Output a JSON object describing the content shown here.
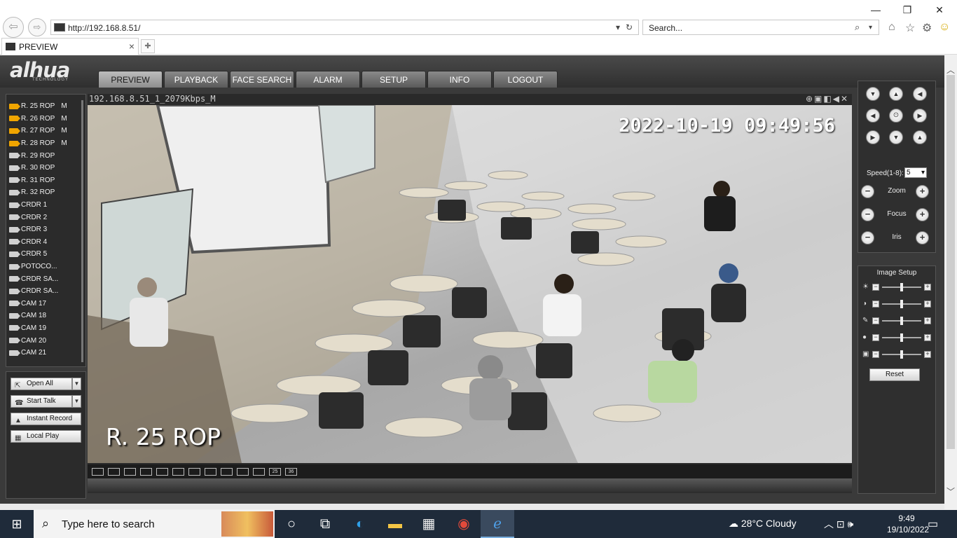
{
  "browser": {
    "url": "http://192.168.8.51/",
    "search_placeholder": "Search...",
    "tab_title": "PREVIEW"
  },
  "nav_menu": [
    {
      "label": "PREVIEW",
      "active": true
    },
    {
      "label": "PLAYBACK",
      "active": false
    },
    {
      "label": "FACE SEARCH",
      "active": false
    },
    {
      "label": "ALARM",
      "active": false
    },
    {
      "label": "SETUP",
      "active": false
    },
    {
      "label": "INFO",
      "active": false
    },
    {
      "label": "LOGOUT",
      "active": false
    }
  ],
  "cameras": [
    {
      "name": "R. 25 ROP",
      "suffix": "M",
      "active": true
    },
    {
      "name": "R. 26 ROP",
      "suffix": "M",
      "active": true
    },
    {
      "name": "R. 27 ROP",
      "suffix": "M",
      "active": true
    },
    {
      "name": "R. 28 ROP",
      "suffix": "M",
      "active": true
    },
    {
      "name": "R. 29 ROP",
      "suffix": "",
      "active": false
    },
    {
      "name": "R. 30 ROP",
      "suffix": "",
      "active": false
    },
    {
      "name": "R. 31 ROP",
      "suffix": "",
      "active": false
    },
    {
      "name": "R. 32 ROP",
      "suffix": "",
      "active": false
    },
    {
      "name": "CRDR 1",
      "suffix": "",
      "active": false
    },
    {
      "name": "CRDR 2",
      "suffix": "",
      "active": false
    },
    {
      "name": "CRDR 3",
      "suffix": "",
      "active": false
    },
    {
      "name": "CRDR 4",
      "suffix": "",
      "active": false
    },
    {
      "name": "CRDR 5",
      "suffix": "",
      "active": false
    },
    {
      "name": "POTOCO...",
      "suffix": "",
      "active": false
    },
    {
      "name": "CRDR SA...",
      "suffix": "",
      "active": false
    },
    {
      "name": "CRDR SA...",
      "suffix": "",
      "active": false
    },
    {
      "name": "CAM 17",
      "suffix": "",
      "active": false
    },
    {
      "name": "CAM 18",
      "suffix": "",
      "active": false
    },
    {
      "name": "CAM 19",
      "suffix": "",
      "active": false
    },
    {
      "name": "CAM 20",
      "suffix": "",
      "active": false
    },
    {
      "name": "CAM 21",
      "suffix": "",
      "active": false
    }
  ],
  "actions": {
    "open_all": "Open All",
    "start_talk": "Start Talk",
    "instant_record": "Instant Record",
    "local_play": "Local Play"
  },
  "video": {
    "stream_title": "192.168.8.51_1_2079Kbps_M",
    "osd_timestamp": "2022-10-19 09:49:56",
    "osd_channel_name": "R. 25 ROP"
  },
  "layout_buttons": [
    "",
    "",
    "",
    "",
    "",
    "",
    "",
    "",
    "",
    "",
    "",
    "25",
    "36"
  ],
  "ptz": {
    "speed_label": "Speed(1-8):",
    "speed_value": "5",
    "zoom_label": "Zoom",
    "focus_label": "Focus",
    "iris_label": "Iris"
  },
  "image_setup": {
    "title": "Image Setup",
    "reset_label": "Reset",
    "sliders": [
      {
        "icon": "brightness-icon",
        "level": 0.5
      },
      {
        "icon": "contrast-icon",
        "level": 0.5
      },
      {
        "icon": "saturation-icon",
        "level": 0.5
      },
      {
        "icon": "hue-icon",
        "level": 0.5
      },
      {
        "icon": "sharpness-icon",
        "level": 0.5
      }
    ]
  },
  "taskbar": {
    "search_placeholder": "Type here to search",
    "weather": "28°C  Cloudy",
    "time": "9:49",
    "date": "19/10/2022"
  },
  "colors": {
    "active_camera": "#f0a500",
    "page_bg": "#3a3a3a",
    "taskbar_bg": "#1f2b3a"
  }
}
